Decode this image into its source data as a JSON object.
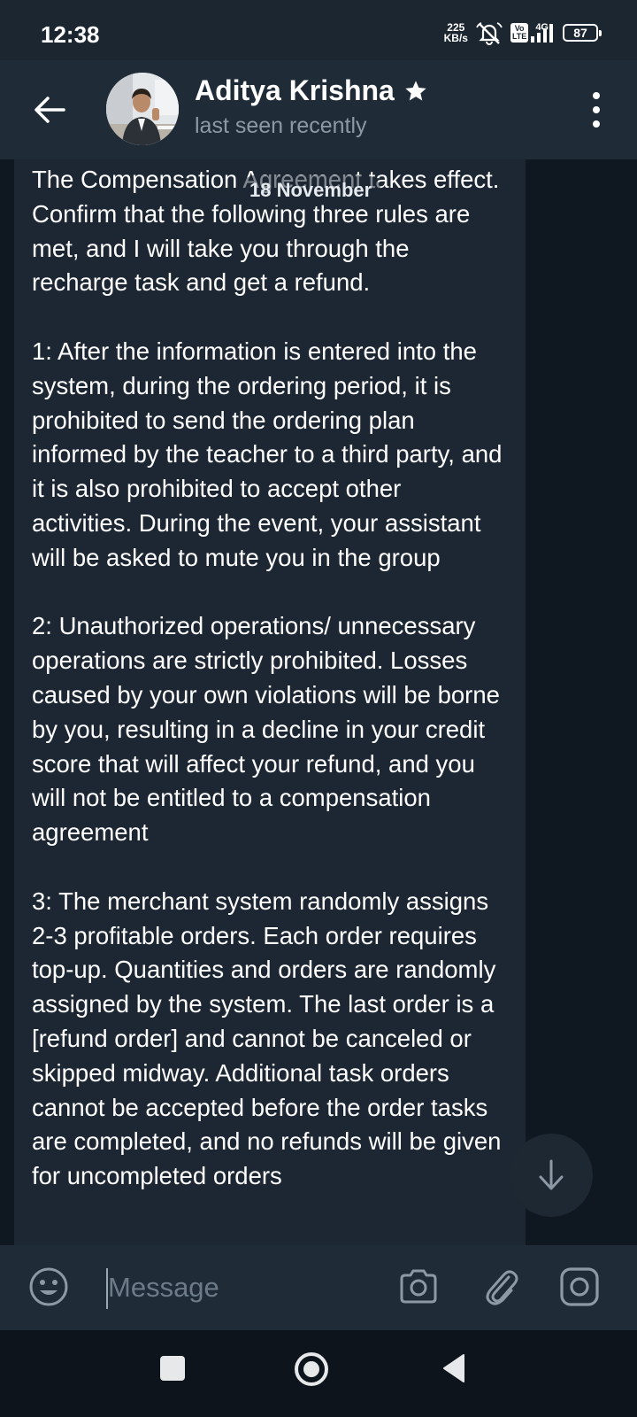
{
  "status_bar": {
    "time": "12:38",
    "speed_value": "225",
    "speed_unit": "KB/s",
    "volte": "Vo\nLTE",
    "network": "4G",
    "battery": "87",
    "icons": [
      "mute-icon",
      "signal-icon"
    ]
  },
  "header": {
    "contact_name": "Aditya Krishna",
    "status": "last seen recently",
    "icons": [
      "back-arrow-icon",
      "star-icon",
      "more-vert-icon"
    ]
  },
  "chat": {
    "date_label": "18 November",
    "message_text": "The Compensation Agreement takes effect. Confirm that the following three rules are met, and I will take you through the recharge task and get a refund.\n\n1: After the information is entered into the system, during the ordering period, it is prohibited to send the ordering plan informed by the teacher to a third party, and it is also prohibited to accept other activities. During the event, your assistant will be asked to mute you in the group\n\n2: Unauthorized operations/ unnecessary operations are strictly prohibited. Losses caused by your own violations will be borne by you, resulting in a decline in your credit score that will affect your refund, and you will not be entitled to a compensation agreement\n\n3: The merchant system randomly assigns 2-3 profitable orders. Each order requires top-up. Quantities and orders are randomly assigned by the system. The last order is a [refund order] and cannot be canceled or skipped midway. Additional task orders cannot be accepted before the order tasks are completed, and no refunds will be given for uncompleted orders",
    "scroll_icon": "arrow-down-icon"
  },
  "input_bar": {
    "placeholder": "Message",
    "icons": [
      "emoji-icon",
      "camera-icon",
      "attach-icon",
      "instagram-icon"
    ]
  },
  "nav_bar": {
    "icons": [
      "recents-square-icon",
      "home-circle-icon",
      "back-triangle-icon"
    ]
  },
  "colors": {
    "header_bg": "#1f2c38",
    "chat_bg": "#0f1721",
    "bubble_bg": "#1d2733",
    "subtitle": "#8d9aa6"
  }
}
